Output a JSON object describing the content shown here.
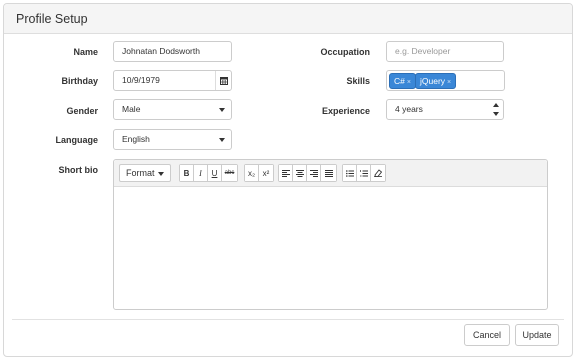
{
  "panel": {
    "title": "Profile Setup"
  },
  "form": {
    "name": {
      "label": "Name",
      "value": "Johnatan Dodsworth"
    },
    "birthday": {
      "label": "Birthday",
      "value": "10/9/1979"
    },
    "gender": {
      "label": "Gender",
      "value": "Male"
    },
    "language": {
      "label": "Language",
      "value": "English"
    },
    "occupation": {
      "label": "Occupation",
      "placeholder": "e.g. Developer"
    },
    "skills": {
      "label": "Skills",
      "tags": [
        {
          "label": "C#",
          "remove": "×"
        },
        {
          "label": "jQuery",
          "remove": "×"
        }
      ]
    },
    "experience": {
      "label": "Experience",
      "value": "4 years"
    },
    "bio": {
      "label": "Short bio"
    }
  },
  "editor_toolbar": {
    "format_label": "Format",
    "bold": "B",
    "italic": "I",
    "underline": "U",
    "strikethrough": "abc",
    "subscript": "x₂",
    "superscript": "x²"
  },
  "actions": {
    "cancel": "Cancel",
    "update": "Update"
  },
  "colors": {
    "tag": "#3a87d7",
    "panel_heading": "#f5f5f5",
    "border": "#cccccc"
  }
}
